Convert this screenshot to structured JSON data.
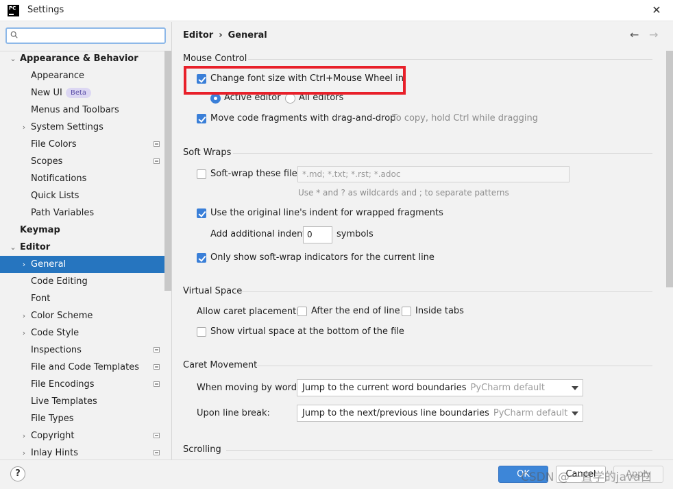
{
  "window": {
    "title": "Settings",
    "icon_text": "PC",
    "close_glyph": "✕"
  },
  "search": {
    "value": "",
    "placeholder": ""
  },
  "tree": [
    {
      "label": "Appearance & Behavior",
      "level": 0,
      "arrow": "⌄",
      "bold": true
    },
    {
      "label": "Appearance",
      "level": 1
    },
    {
      "label": "New UI",
      "level": 1,
      "badge": "Beta"
    },
    {
      "label": "Menus and Toolbars",
      "level": 1
    },
    {
      "label": "System Settings",
      "level": 1,
      "arrow": "›"
    },
    {
      "label": "File Colors",
      "level": 1,
      "project_icon": true
    },
    {
      "label": "Scopes",
      "level": 1,
      "project_icon": true
    },
    {
      "label": "Notifications",
      "level": 1
    },
    {
      "label": "Quick Lists",
      "level": 1
    },
    {
      "label": "Path Variables",
      "level": 1
    },
    {
      "label": "Keymap",
      "level": 0,
      "bold": true
    },
    {
      "label": "Editor",
      "level": 0,
      "arrow": "⌄",
      "bold": true
    },
    {
      "label": "General",
      "level": 1,
      "arrow": "›",
      "selected": true
    },
    {
      "label": "Code Editing",
      "level": 1
    },
    {
      "label": "Font",
      "level": 1
    },
    {
      "label": "Color Scheme",
      "level": 1,
      "arrow": "›"
    },
    {
      "label": "Code Style",
      "level": 1,
      "arrow": "›"
    },
    {
      "label": "Inspections",
      "level": 1,
      "project_icon": true
    },
    {
      "label": "File and Code Templates",
      "level": 1,
      "project_icon": true
    },
    {
      "label": "File Encodings",
      "level": 1,
      "project_icon": true
    },
    {
      "label": "Live Templates",
      "level": 1
    },
    {
      "label": "File Types",
      "level": 1
    },
    {
      "label": "Copyright",
      "level": 1,
      "arrow": "›",
      "project_icon": true
    },
    {
      "label": "Inlay Hints",
      "level": 1,
      "arrow": "›",
      "project_icon": true
    }
  ],
  "breadcrumb": {
    "parent": "Editor",
    "separator": "›",
    "current": "General"
  },
  "nav": {
    "back": "←",
    "forward": "→"
  },
  "mouse_control": {
    "title": "Mouse Control",
    "change_font_size": {
      "label": "Change font size with Ctrl+Mouse Wheel in:",
      "checked": true
    },
    "active_editor": {
      "label": "Active editor",
      "selected": true
    },
    "all_editors": {
      "label": "All editors",
      "selected": false
    },
    "move_code": {
      "label": "Move code fragments with drag-and-drop",
      "checked": true,
      "hint": "To copy, hold Ctrl while dragging"
    }
  },
  "soft_wraps": {
    "title": "Soft Wraps",
    "soft_wrap_files": {
      "label": "Soft-wrap these files:",
      "checked": false,
      "value": "*.md; *.txt; *.rst; *.adoc"
    },
    "wildcard_hint": "Use * and ? as wildcards and ; to separate patterns",
    "use_indent": {
      "label": "Use the original line's indent for wrapped fragments",
      "checked": true
    },
    "additional_indent": {
      "label": "Add additional indent:",
      "value": "0",
      "unit": "symbols"
    },
    "only_current": {
      "label": "Only show soft-wrap indicators for the current line",
      "checked": true
    }
  },
  "virtual_space": {
    "title": "Virtual Space",
    "caret_label": "Allow caret placement:",
    "after_end": {
      "label": "After the end of line",
      "checked": false
    },
    "inside_tabs": {
      "label": "Inside tabs",
      "checked": false
    },
    "show_virtual": {
      "label": "Show virtual space at the bottom of the file",
      "checked": false
    }
  },
  "caret_movement": {
    "title": "Caret Movement",
    "words": {
      "label": "When moving by words:",
      "value": "Jump to the current word boundaries",
      "hint": "PyCharm default"
    },
    "line_break": {
      "label": "Upon line break:",
      "value": "Jump to the next/previous line boundaries",
      "hint": "PyCharm default"
    }
  },
  "scrolling": {
    "title": "Scrolling"
  },
  "buttons": {
    "help": "?",
    "ok": "OK",
    "cancel": "Cancel",
    "apply": "Apply"
  },
  "watermark": "CSDN @一直学的java白",
  "colors": {
    "selection": "#2675bf",
    "checkbox": "#3a7fd8",
    "highlight": "#e8202a"
  }
}
